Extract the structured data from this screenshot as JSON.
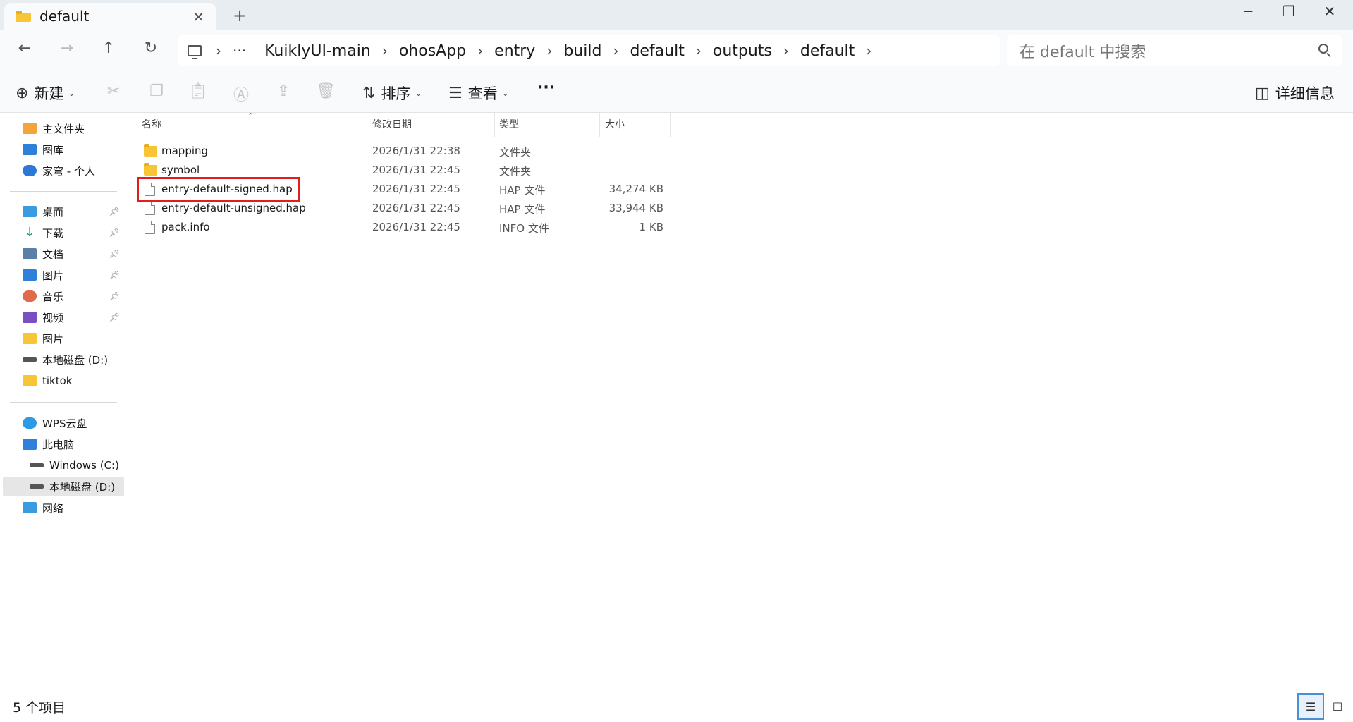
{
  "window": {
    "tab_title": "default",
    "tab_close": "✕",
    "new_tab": "+",
    "minimize": "─",
    "restore": "❐",
    "close": "✕"
  },
  "nav": {
    "back": "←",
    "forward": "→",
    "up": "↑",
    "refresh": "↻"
  },
  "address": {
    "ellipsis": "···",
    "separator": "›",
    "crumbs": [
      "KuiklyUI-main",
      "ohosApp",
      "entry",
      "build",
      "default",
      "outputs",
      "default"
    ]
  },
  "search": {
    "placeholder": "在 default 中搜索"
  },
  "toolbar": {
    "new_label": "新建",
    "sort_label": "排序",
    "view_label": "查看",
    "more": "···",
    "details_label": "详细信息"
  },
  "sidebar": {
    "group1": [
      {
        "label": "主文件夹",
        "icon": "home-icon"
      },
      {
        "label": "图库",
        "icon": "gallery-icon"
      },
      {
        "label": "家穹 - 个人",
        "icon": "cloud-icon"
      }
    ],
    "group2": [
      {
        "label": "桌面",
        "icon": "desktop-icon",
        "pinned": true
      },
      {
        "label": "下载",
        "icon": "download-icon",
        "pinned": true
      },
      {
        "label": "文档",
        "icon": "documents-icon",
        "pinned": true
      },
      {
        "label": "图片",
        "icon": "pictures-icon",
        "pinned": true
      },
      {
        "label": "音乐",
        "icon": "music-icon",
        "pinned": true
      },
      {
        "label": "视频",
        "icon": "videos-icon",
        "pinned": true
      },
      {
        "label": "图片",
        "icon": "folder-icon",
        "pinned": false
      },
      {
        "label": "本地磁盘 (D:)",
        "icon": "drive-icon",
        "pinned": false
      },
      {
        "label": "tiktok",
        "icon": "folder-icon",
        "pinned": false
      }
    ],
    "group3": [
      {
        "label": "WPS云盘",
        "icon": "wps-cloud-icon"
      },
      {
        "label": "此电脑",
        "icon": "this-pc-icon"
      },
      {
        "label": "Windows (C:)",
        "icon": "drive-c-icon"
      },
      {
        "label": "本地磁盘 (D:)",
        "icon": "drive-d-icon",
        "selected": true
      },
      {
        "label": "网络",
        "icon": "network-icon"
      }
    ]
  },
  "columns": {
    "name": "名称",
    "modified": "修改日期",
    "type": "类型",
    "size": "大小"
  },
  "files": [
    {
      "name": "mapping",
      "modified": "2026/1/31 22:38",
      "type": "文件夹",
      "size": "",
      "kind": "folder"
    },
    {
      "name": "symbol",
      "modified": "2026/1/31 22:45",
      "type": "文件夹",
      "size": "",
      "kind": "folder"
    },
    {
      "name": "entry-default-signed.hap",
      "modified": "2026/1/31 22:45",
      "type": "HAP 文件",
      "size": "34,274 KB",
      "kind": "file",
      "highlighted": true
    },
    {
      "name": "entry-default-unsigned.hap",
      "modified": "2026/1/31 22:45",
      "type": "HAP 文件",
      "size": "33,944 KB",
      "kind": "file"
    },
    {
      "name": "pack.info",
      "modified": "2026/1/31 22:45",
      "type": "INFO 文件",
      "size": "1 KB",
      "kind": "file"
    }
  ],
  "status": {
    "item_count": "5 个项目"
  },
  "colors": {
    "highlight": "#e01e1e",
    "folder": "#f8c537",
    "selected_view": "#4a8fd6"
  }
}
